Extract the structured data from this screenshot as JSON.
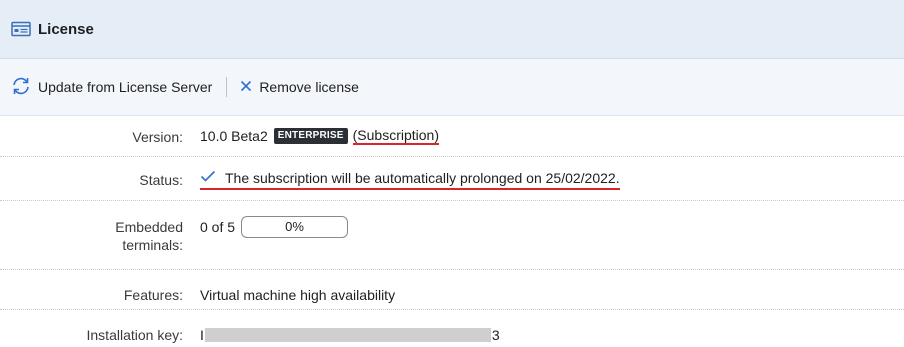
{
  "panel": {
    "title": "License",
    "icon": "license-card-icon"
  },
  "toolbar": {
    "update_label": "Update from License Server",
    "update_icon": "refresh-icon",
    "remove_label": "Remove license",
    "remove_icon": "close-icon"
  },
  "fields": {
    "version": {
      "label": "Version:",
      "value": "10.0 Beta2",
      "edition_badge": "ENTERPRISE",
      "license_type": "(Subscription)"
    },
    "status": {
      "label": "Status:",
      "icon": "checkmark-icon",
      "value": "The subscription will be automatically prolonged on 25/02/2022."
    },
    "embedded_terminals": {
      "label_line1": "Embedded",
      "label_line2": "terminals:",
      "count_text": "0 of 5",
      "progress_percent": 0,
      "progress_text": "0%"
    },
    "features": {
      "label": "Features:",
      "value": "Virtual machine high availability"
    },
    "installation_key": {
      "label": "Installation key:",
      "prefix": "I",
      "suffix": "3"
    }
  },
  "colors": {
    "title_bar_bg": "#e5edf7",
    "toolbar_bg": "#f3f6fb",
    "accent_blue": "#2f6fd0",
    "underline_red": "#d9262c",
    "badge_bg": "#2b2f36"
  }
}
